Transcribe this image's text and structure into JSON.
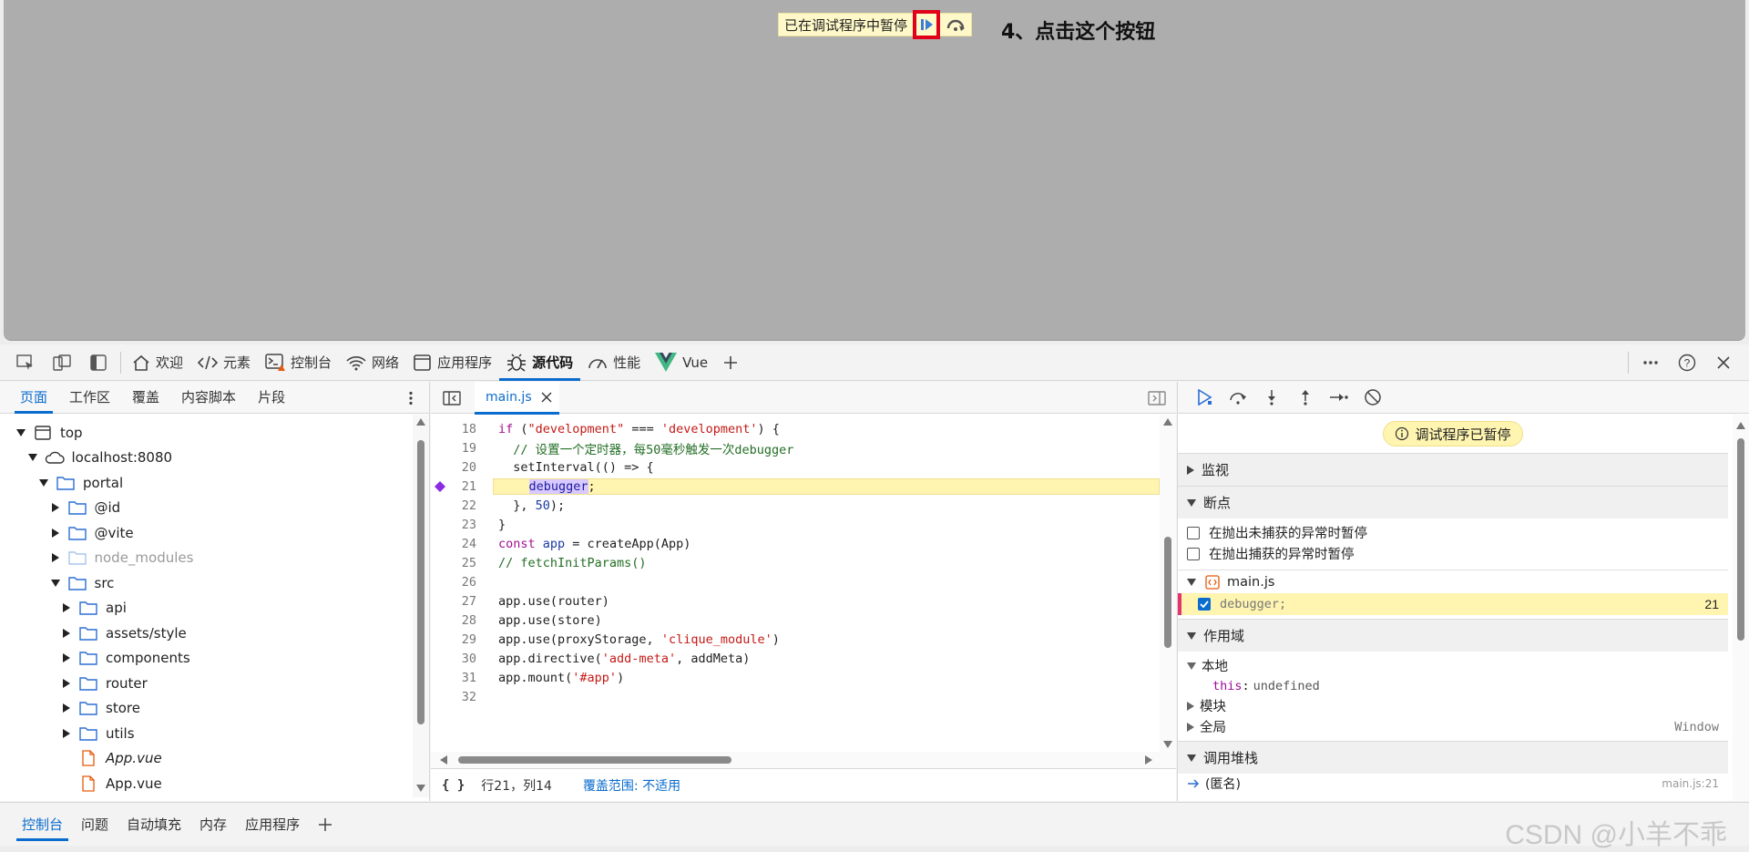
{
  "viewport": {
    "paused_label": "已在调试程序中暂停",
    "annotation": "4、点击这个按钮"
  },
  "toolbar": {
    "tabs": [
      {
        "label": "欢迎",
        "icon": "home-icon"
      },
      {
        "label": "元素",
        "icon": "code-tags-icon"
      },
      {
        "label": "控制台",
        "icon": "console-icon"
      },
      {
        "label": "网络",
        "icon": "wifi-icon"
      },
      {
        "label": "应用程序",
        "icon": "app-window-icon"
      },
      {
        "label": "源代码",
        "icon": "bug-icon",
        "active": true
      },
      {
        "label": "性能",
        "icon": "gauge-icon"
      },
      {
        "label": "Vue",
        "icon": "vue-logo-icon"
      }
    ]
  },
  "navigator": {
    "tabs": [
      "页面",
      "工作区",
      "覆盖",
      "内容脚本",
      "片段"
    ],
    "active_tab": "页面",
    "tree": [
      {
        "label": "top",
        "depth": 0,
        "expanded": true,
        "icon": "frame-icon"
      },
      {
        "label": "localhost:8080",
        "depth": 1,
        "expanded": true,
        "icon": "cloud-icon"
      },
      {
        "label": "portal",
        "depth": 2,
        "expanded": true,
        "icon": "folder-icon"
      },
      {
        "label": "@id",
        "depth": 3,
        "expanded": false,
        "icon": "folder-icon"
      },
      {
        "label": "@vite",
        "depth": 3,
        "expanded": false,
        "icon": "folder-icon"
      },
      {
        "label": "node_modules",
        "depth": 3,
        "expanded": false,
        "icon": "folder-icon",
        "dim": true
      },
      {
        "label": "src",
        "depth": 3,
        "expanded": true,
        "icon": "folder-icon"
      },
      {
        "label": "api",
        "depth": 4,
        "expanded": false,
        "icon": "folder-icon"
      },
      {
        "label": "assets/style",
        "depth": 4,
        "expanded": false,
        "icon": "folder-icon"
      },
      {
        "label": "components",
        "depth": 4,
        "expanded": false,
        "icon": "folder-icon"
      },
      {
        "label": "router",
        "depth": 4,
        "expanded": false,
        "icon": "folder-icon"
      },
      {
        "label": "store",
        "depth": 4,
        "expanded": false,
        "icon": "folder-icon"
      },
      {
        "label": "utils",
        "depth": 4,
        "expanded": false,
        "icon": "folder-icon"
      },
      {
        "label": "App.vue",
        "depth": 4,
        "file": true,
        "icon": "file-icon",
        "italic": true
      },
      {
        "label": "App.vue",
        "depth": 4,
        "file": true,
        "icon": "file-icon"
      }
    ]
  },
  "editor": {
    "file_tab": "main.js",
    "status_position": "行21，列14",
    "status_coverage": "覆盖范围: 不适用",
    "lines": [
      {
        "n": 18,
        "html": "<span class=\"kw\">if</span> (<span class=\"str\">\"development\"</span> === <span class=\"str\">'development'</span>) {"
      },
      {
        "n": 19,
        "html": "  <span class=\"cmt\">// 设置一个定时器，每50毫秒触发一次debugger</span>"
      },
      {
        "n": 20,
        "html": "  setInterval(() => {"
      },
      {
        "n": 21,
        "html": "    <span class=\"dbg\">debugger</span>;",
        "highlight": true,
        "breakpoint": true
      },
      {
        "n": 22,
        "html": "  }, <span class=\"ident\">50</span>);"
      },
      {
        "n": 23,
        "html": "}"
      },
      {
        "n": 24,
        "html": "<span class=\"kw\">const</span> <span class=\"ident\">app</span> = createApp(App)"
      },
      {
        "n": 25,
        "html": "<span class=\"cmt\">// fetchInitParams()</span>"
      },
      {
        "n": 26,
        "html": ""
      },
      {
        "n": 27,
        "html": "app.use(router)"
      },
      {
        "n": 28,
        "html": "app.use(store)"
      },
      {
        "n": 29,
        "html": "app.use(proxyStorage, <span class=\"str\">'clique_module'</span>)"
      },
      {
        "n": 30,
        "html": "app.directive(<span class=\"str\">'add-meta'</span>, addMeta)"
      },
      {
        "n": 31,
        "html": "app.mount(<span class=\"str\">'#app'</span>)"
      },
      {
        "n": 32,
        "html": ""
      }
    ]
  },
  "debugger": {
    "paused_pill": "调试程序已暂停",
    "watch_label": "监视",
    "breakpoints_label": "断点",
    "pause_uncaught": "在抛出未捕获的异常时暂停",
    "pause_caught": "在抛出捕获的异常时暂停",
    "bp_file": "main.js",
    "bp_code": "debugger;",
    "bp_line": "21",
    "scope_label": "作用域",
    "scope_local": "本地",
    "scope_this_key": "this",
    "scope_this_val": "undefined",
    "scope_module": "模块",
    "scope_global": "全局",
    "scope_global_val": "Window",
    "callstack_label": "调用堆栈",
    "callstack_first": "(匿名)",
    "callstack_first_loc": "main.js:21"
  },
  "drawer": {
    "tabs": [
      "控制台",
      "问题",
      "自动填充",
      "内存",
      "应用程序"
    ],
    "active_tab": "控制台",
    "watermark": "CSDN @小羊不乖"
  }
}
